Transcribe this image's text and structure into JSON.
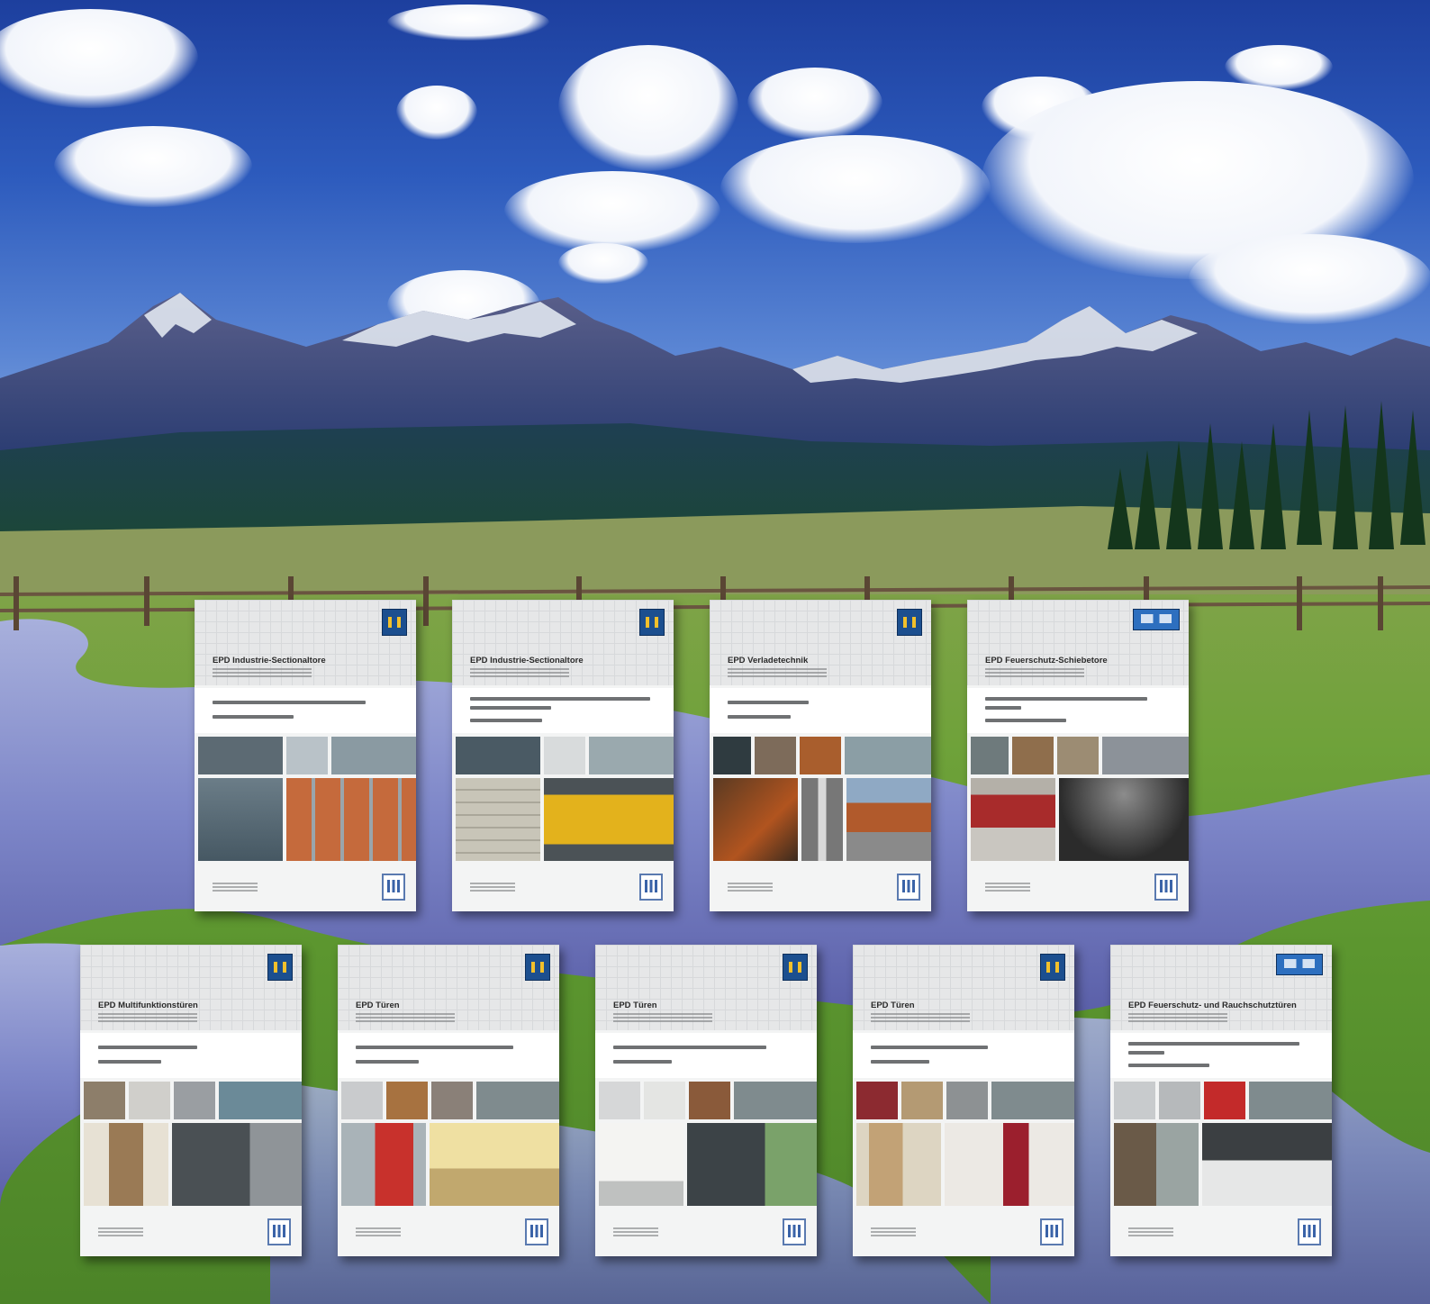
{
  "image": {
    "description_colors": {
      "sky_top": "#1d3f9e",
      "snow": "#e9eef6",
      "meadow": "#6fa23a",
      "river": "#7d86c8",
      "card_bg": "#f3f4f4",
      "hormann_blue": "#1c4f8f",
      "hormann_yellow": "#f2c02b"
    }
  },
  "cards": [
    {
      "title": "EPD Industrie-Sectionaltore",
      "logo": "hormann-logo",
      "photos": [
        "#5c6a73",
        "#b9c2c8",
        "#8a9aa2",
        "#465863",
        "#c56a3c"
      ]
    },
    {
      "title": "EPD Industrie-Sectionaltore",
      "logo": "hormann-logo",
      "photos": [
        "#4a5a64",
        "#d8dbdc",
        "#9aa9ae",
        "#b8b5a8",
        "#e3b21c"
      ]
    },
    {
      "title": "EPD Verladetechnik",
      "logo": "hormann-logo",
      "photos": [
        "#2f3b40",
        "#7d6b5a",
        "#a95e2d",
        "#8b9ea5",
        "#b1541f"
      ]
    },
    {
      "title": "EPD Feuerschutz-Schiebetore",
      "logo": "teckentrup-logo",
      "photos": [
        "#6e7a7c",
        "#8f6e4c",
        "#9c8c73",
        "#8c9299",
        "#a82b2b"
      ]
    },
    {
      "title": "EPD Multifunktionstüren",
      "logo": "hormann-logo",
      "photos": [
        "#8d7e6a",
        "#d0cfcb",
        "#9a9ea2",
        "#6b8a98",
        "#9a7a55"
      ]
    },
    {
      "title": "EPD Türen",
      "logo": "hormann-logo",
      "photos": [
        "#c9cbcd",
        "#a77240",
        "#8a8078",
        "#7f8b8e",
        "#c8312c"
      ]
    },
    {
      "title": "EPD Türen",
      "logo": "hormann-logo",
      "photos": [
        "#d6d7d8",
        "#e4e5e3",
        "#8a5a3a",
        "#7f8b8e",
        "#3c4347"
      ]
    },
    {
      "title": "EPD Türen",
      "logo": "hormann-logo",
      "photos": [
        "#8c2a30",
        "#b49a73",
        "#8d9193",
        "#7f8b8e",
        "#c2a276"
      ]
    },
    {
      "title": "EPD Feuerschutz- und Rauchschutztüren",
      "logo": "teckentrup-logo",
      "photos": [
        "#c8cbcd",
        "#b6b9bb",
        "#c32a2a",
        "#7f8b8e",
        "#6a5a48"
      ]
    }
  ]
}
